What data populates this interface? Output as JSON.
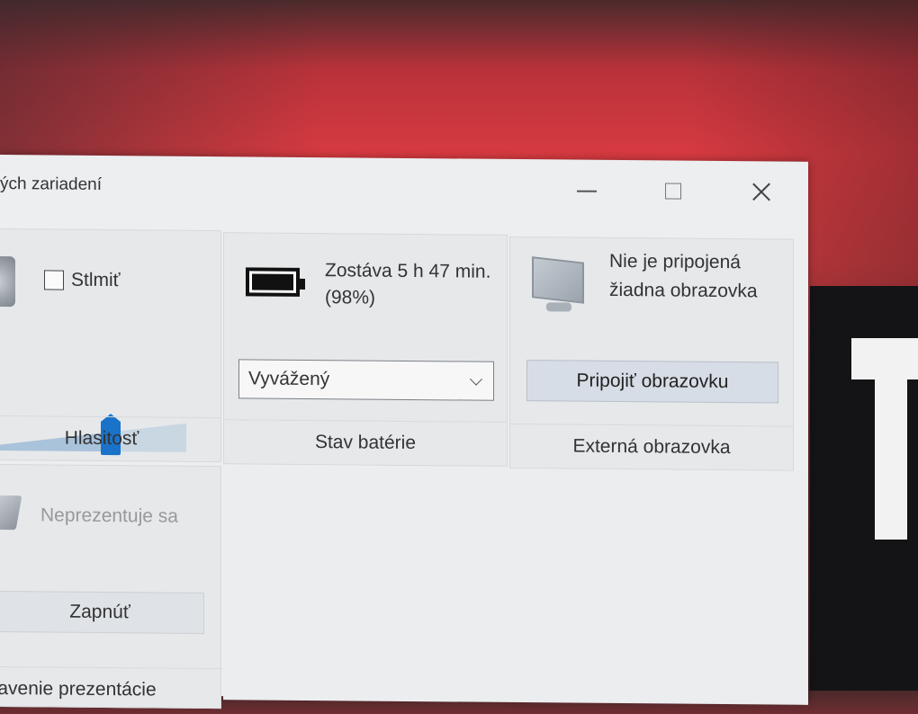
{
  "window": {
    "title": "ých zariadení",
    "controls": {
      "minimize_icon": "minimize-icon",
      "maximize_icon": "maximize-icon",
      "close_icon": "close-icon"
    }
  },
  "volume": {
    "mute_label": "Stlmiť",
    "mute_checked": false,
    "level": 0.6,
    "footer": "Hlasitosť"
  },
  "battery": {
    "status_text": "Zostáva 5 h 47 min. (98%)",
    "plan_selected": "Vyvážený",
    "footer": "Stav batérie"
  },
  "display": {
    "status_text": "Nie je pripojená žiadna obrazovka",
    "connect_label": "Pripojiť obrazovku",
    "footer": "Externá obrazovka"
  },
  "presentation": {
    "status_text": "Neprezentuje sa",
    "button_label": "Zapnúť",
    "footer": "stavenie prezentácie"
  },
  "colors": {
    "accent": "#1a73c8",
    "window_bg": "#edeef0",
    "tile_bg": "#e6e8ea"
  }
}
